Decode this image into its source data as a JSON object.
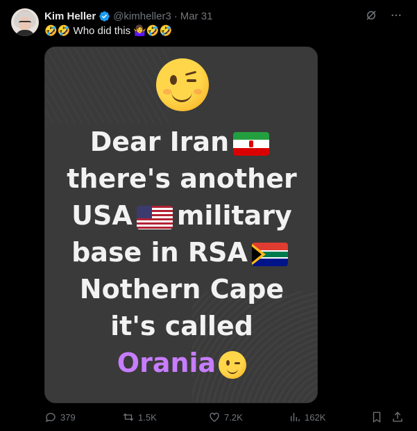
{
  "author": {
    "name": "Kim Heller",
    "handle": "@kimheller3",
    "separator": "·",
    "date": "Mar 31"
  },
  "tweet": {
    "text_prefix_emoji": "🤣🤣",
    "text": "Who did this",
    "text_suffix_emoji": "🤷‍♀️🤣🤣"
  },
  "media": {
    "lines": [
      "Dear Iran",
      "there's another",
      "USA",
      "military",
      "base in RSA",
      "Nothern Cape",
      "it's called"
    ],
    "highlight": "Orania",
    "colors": {
      "background": "#3a3a3a",
      "text": "#f2f2f2",
      "highlight": "#c77dff"
    }
  },
  "actions": {
    "replies": "379",
    "reposts": "1.5K",
    "likes": "7.2K",
    "views": "162K"
  },
  "icons": [
    "verified-badge-icon",
    "grok-icon",
    "more-icon",
    "reply-icon",
    "repost-icon",
    "like-icon",
    "views-icon",
    "bookmark-icon",
    "share-icon"
  ]
}
